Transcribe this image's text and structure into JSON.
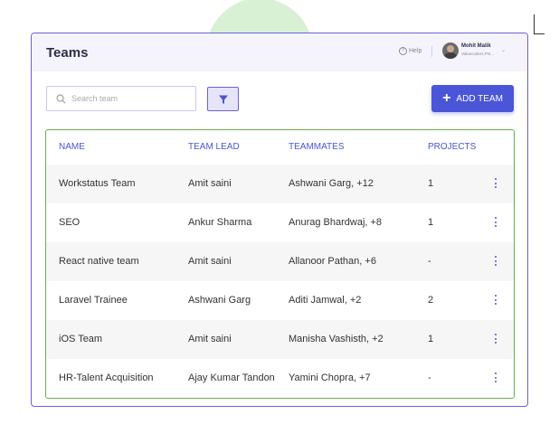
{
  "header": {
    "title": "Teams",
    "help_label": "Help",
    "user_name": "Mohit Malik",
    "user_company": "Valuecoders Pvt...",
    "help_icon": "question-circle-icon",
    "chevron_icon": "chevron-down-icon"
  },
  "toolbar": {
    "search_placeholder": "Search team",
    "add_button_label": "ADD TEAM",
    "filter_icon": "filter-funnel-icon"
  },
  "colors": {
    "accent": "#4a55d8",
    "card_border": "#6b61d8",
    "table_border": "#6ab04c",
    "header_bg": "#f5f4fd"
  },
  "table": {
    "columns": [
      "NAME",
      "TEAM LEAD",
      "TEAMMATES",
      "PROJECTS"
    ],
    "rows": [
      {
        "name": "Workstatus Team",
        "lead": "Amit saini",
        "mates": "Ashwani Garg, +12",
        "projects": "1"
      },
      {
        "name": "SEO",
        "lead": "Ankur Sharma",
        "mates": "Anurag Bhardwaj, +8",
        "projects": "1"
      },
      {
        "name": "React native team",
        "lead": "Amit saini",
        "mates": "Allanoor Pathan, +6",
        "projects": "-"
      },
      {
        "name": "Laravel Trainee",
        "lead": "Ashwani Garg",
        "mates": "Aditi Jamwal, +2",
        "projects": "2"
      },
      {
        "name": "iOS Team",
        "lead": "Amit saini",
        "mates": "Manisha Vashisth, +2",
        "projects": "1"
      },
      {
        "name": "HR-Talent Acquisition",
        "lead": "Ajay Kumar Tandon",
        "mates": "Yamini Chopra, +7",
        "projects": "-"
      }
    ]
  }
}
